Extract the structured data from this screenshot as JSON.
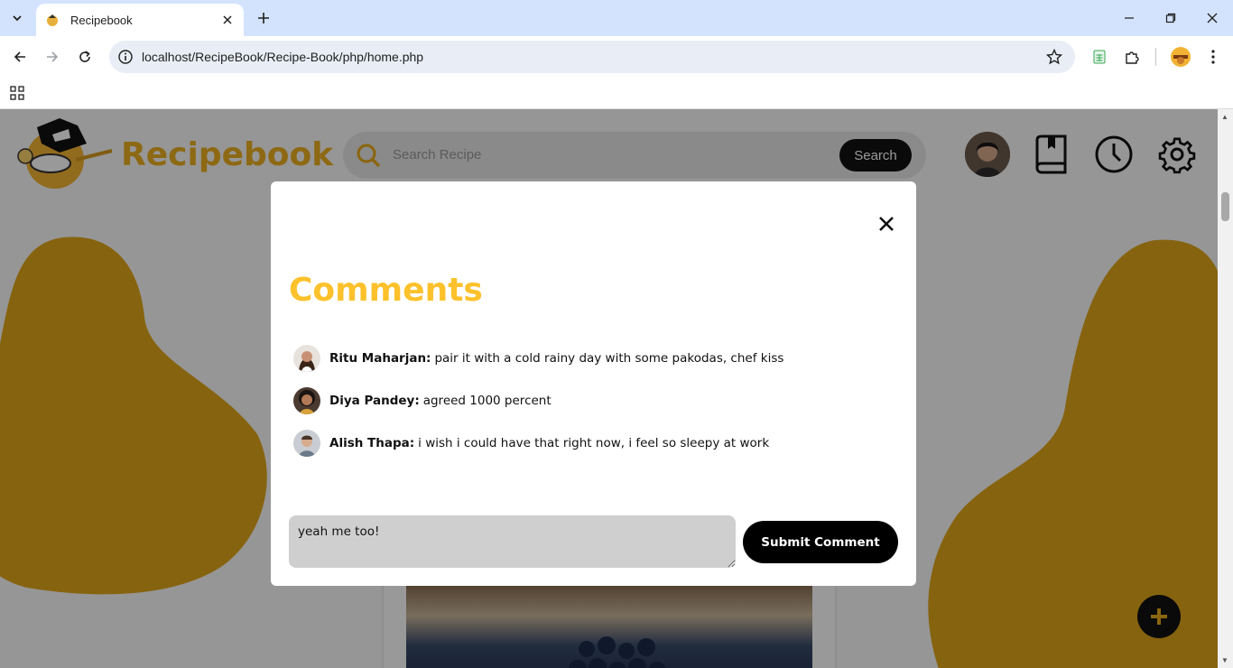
{
  "browser": {
    "tab_title": "Recipebook",
    "url": "localhost/RecipeBook/Recipe-Book/php/home.php"
  },
  "header": {
    "brand": "Recipebook",
    "search_placeholder": "Search Recipe",
    "search_button": "Search"
  },
  "modal": {
    "title": "Comments",
    "comments": [
      {
        "name": "Ritu Maharjan:",
        "text": "pair it with a cold rainy day with some pakodas, chef kiss"
      },
      {
        "name": "Diya Pandey:",
        "text": "agreed 1000 percent"
      },
      {
        "name": "Alish Thapa:",
        "text": "i wish i could have that right now, i feel so sleepy at work"
      }
    ],
    "input_value": "yeah me too!",
    "submit_label": "Submit Comment"
  },
  "colors": {
    "brand_yellow": "#ecb022",
    "comments_heading": "#fdc12b",
    "blob": "#e0a61a"
  }
}
